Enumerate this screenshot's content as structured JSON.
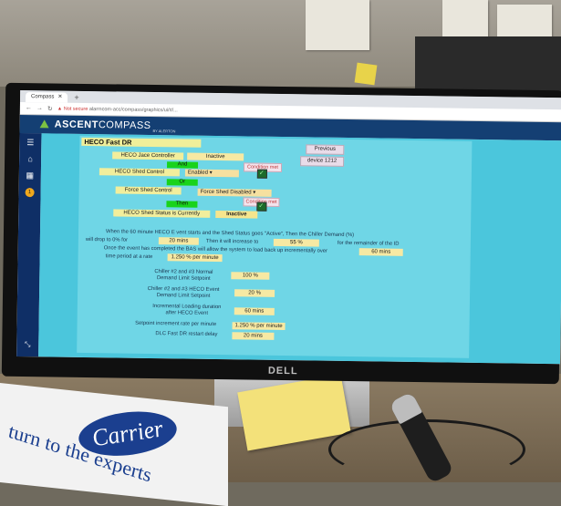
{
  "browser": {
    "tab_label": "Compass",
    "url_warning": "Not secure",
    "url": "alarmcom-acc/compass/graphics/ui/#/..."
  },
  "app": {
    "brand_bold": "ASCENT",
    "brand_light": "COMPASS",
    "brand_sub": "BY ALERTON"
  },
  "sidebar": {
    "badge": "1"
  },
  "page": {
    "title": "HECO Fast DR",
    "previous_button": "Previous",
    "device_button": "device 1212",
    "jace_label": "HECO Jace Controller",
    "jace_value": "Inactive",
    "and_label": "And",
    "cond1": "Condition met",
    "shed_label": "HECO Shed Control",
    "shed_value": "Enabled",
    "or_label": "Or",
    "force_label": "Force Shed Control",
    "force_value": "Force Shed Disabled",
    "cond2": "Condition met",
    "then_label": "Then",
    "status_label": "HECO Shed Status is Currently",
    "status_value": "Inactive",
    "para_line1": "When the 60 minute HECO E vent starts and the Shed Status goes \"Active\", Then the Chiller Demand (%)",
    "para_line2a": "will drop to 0% for",
    "para_val1": "20 mins",
    "para_line2b": "Then it will increase to",
    "para_val2": "55 %",
    "para_line2c": "for the remainder of the ID",
    "para_line3a": "Once the event has completed the BAS will allow the system to load back up incrementally over",
    "para_val3": "60 mins",
    "para_line4a": "time period at a rate",
    "para_val4": "1.250 % per minute",
    "f1_label": "Chiller #2 and #3 Normal Demand Limit Setpoint",
    "f1_value": "100 %",
    "f2_label": "Chiller #2 and #3 HECO Event Demand Limit Setpoint",
    "f2_value": "20 %",
    "f3_label": "Incremental Loading duration after HECO Event",
    "f3_value": "60 mins",
    "f4_label": "Setpoint increment rate per minute",
    "f4_value": "1.250 % per minute",
    "f5_label": "DLC Fast DR restart delay",
    "f5_value": "20 mins"
  },
  "monitor": {
    "brand": "DELL"
  },
  "desk": {
    "carrier_logo": "Carrier",
    "carrier_tagline": "turn to the experts"
  }
}
